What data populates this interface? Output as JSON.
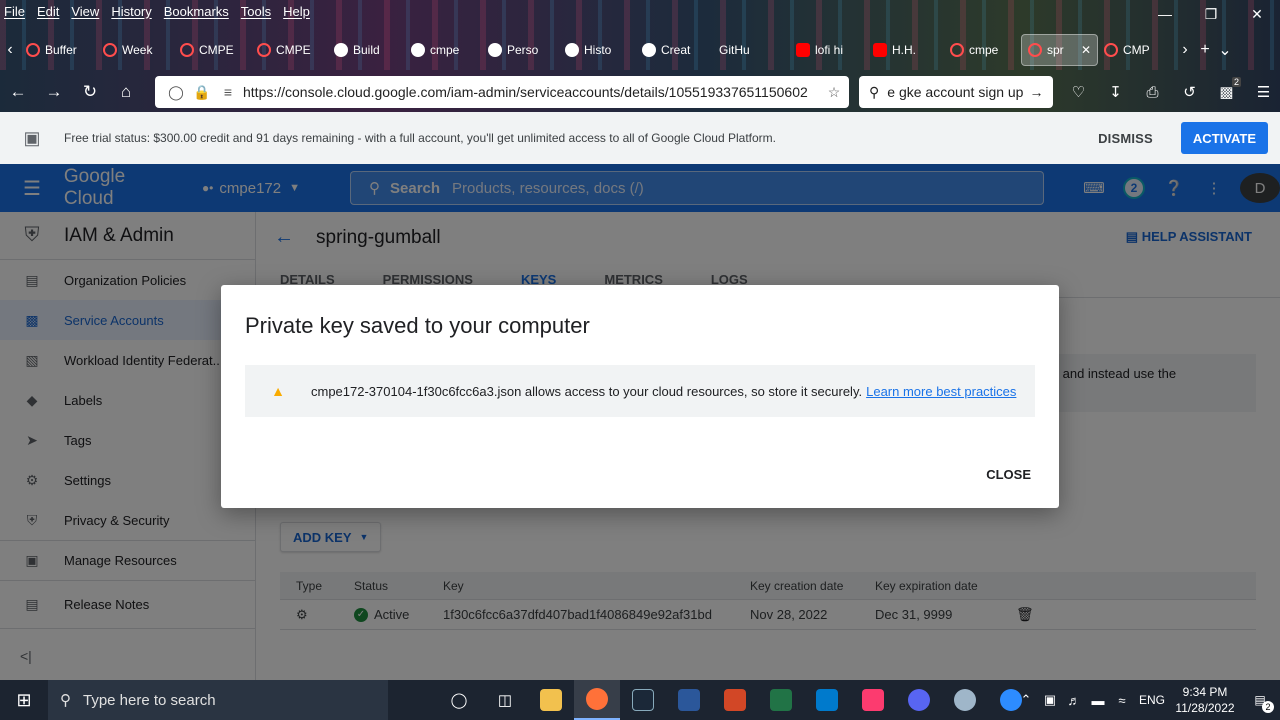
{
  "browser": {
    "menu": [
      "File",
      "Edit",
      "View",
      "History",
      "Bookmarks",
      "Tools",
      "Help"
    ],
    "tabs": [
      "Buffer",
      "Week",
      "CMPE",
      "CMPE",
      "Build",
      "cmpe",
      "Perso",
      "Histo",
      "Creat",
      "GitHu",
      "lofi hi",
      "H.H.",
      "cmpe",
      "spr",
      "CMP"
    ],
    "url": "https://console.cloud.google.com/iam-admin/serviceaccounts/details/105519337651150602",
    "search_text": "e gke account sign up",
    "notification_count": "2"
  },
  "trial_banner": {
    "message": "Free trial status: $300.00 credit and 91 days remaining - with a full account, you'll get unlimited access to all of Google Cloud Platform.",
    "dismiss": "DISMISS",
    "activate": "ACTIVATE"
  },
  "header": {
    "logo": "Google Cloud",
    "project": "cmpe172",
    "search_label": "Search",
    "search_placeholder": "Products, resources, docs (/)",
    "notification_badge": "2",
    "avatar_letter": "D"
  },
  "sidebar": {
    "title": "IAM & Admin",
    "items": [
      {
        "label": "Organization Policies",
        "icon": "policy-icon"
      },
      {
        "label": "Service Accounts",
        "icon": "service-account-icon"
      },
      {
        "label": "Workload Identity Federat...",
        "icon": "workload-identity-icon"
      },
      {
        "label": "Labels",
        "icon": "label-icon"
      },
      {
        "label": "Tags",
        "icon": "tag-icon"
      },
      {
        "label": "Settings",
        "icon": "gear-icon"
      },
      {
        "label": "Privacy & Security",
        "icon": "shield-icon"
      }
    ],
    "manage_resources": "Manage Resources",
    "release_notes": "Release Notes"
  },
  "main": {
    "title": "spring-gumball",
    "help_assistant": "HELP ASSISTANT",
    "tabs": [
      "DETAILS",
      "PERMISSIONS",
      "KEYS",
      "METRICS",
      "LOGS"
    ],
    "info_line1": "ys and instead use the",
    "info_line2": "e",
    "add_key": "ADD KEY",
    "table": {
      "headers": [
        "Type",
        "Status",
        "Key",
        "Key creation date",
        "Key expiration date"
      ],
      "rows": [
        {
          "status": "Active",
          "key": "1f30c6fcc6a37dfd407bad1f4086849e92af31bd",
          "created": "Nov 28, 2022",
          "expires": "Dec 31, 9999"
        }
      ]
    }
  },
  "dialog": {
    "title": "Private key saved to your computer",
    "message": "cmpe172-370104-1f30c6fcc6a3.json allows access to your cloud resources, so store it securely.",
    "link": "Learn more best practices",
    "close": "CLOSE"
  },
  "taskbar": {
    "search_placeholder": "Type here to search",
    "language": "ENG",
    "time": "9:34 PM",
    "date": "11/28/2022",
    "notification_count": "2"
  },
  "colors": {
    "accent": "#1a73e8",
    "active_status": "#1e8e3e",
    "warning": "#f9ab00"
  }
}
